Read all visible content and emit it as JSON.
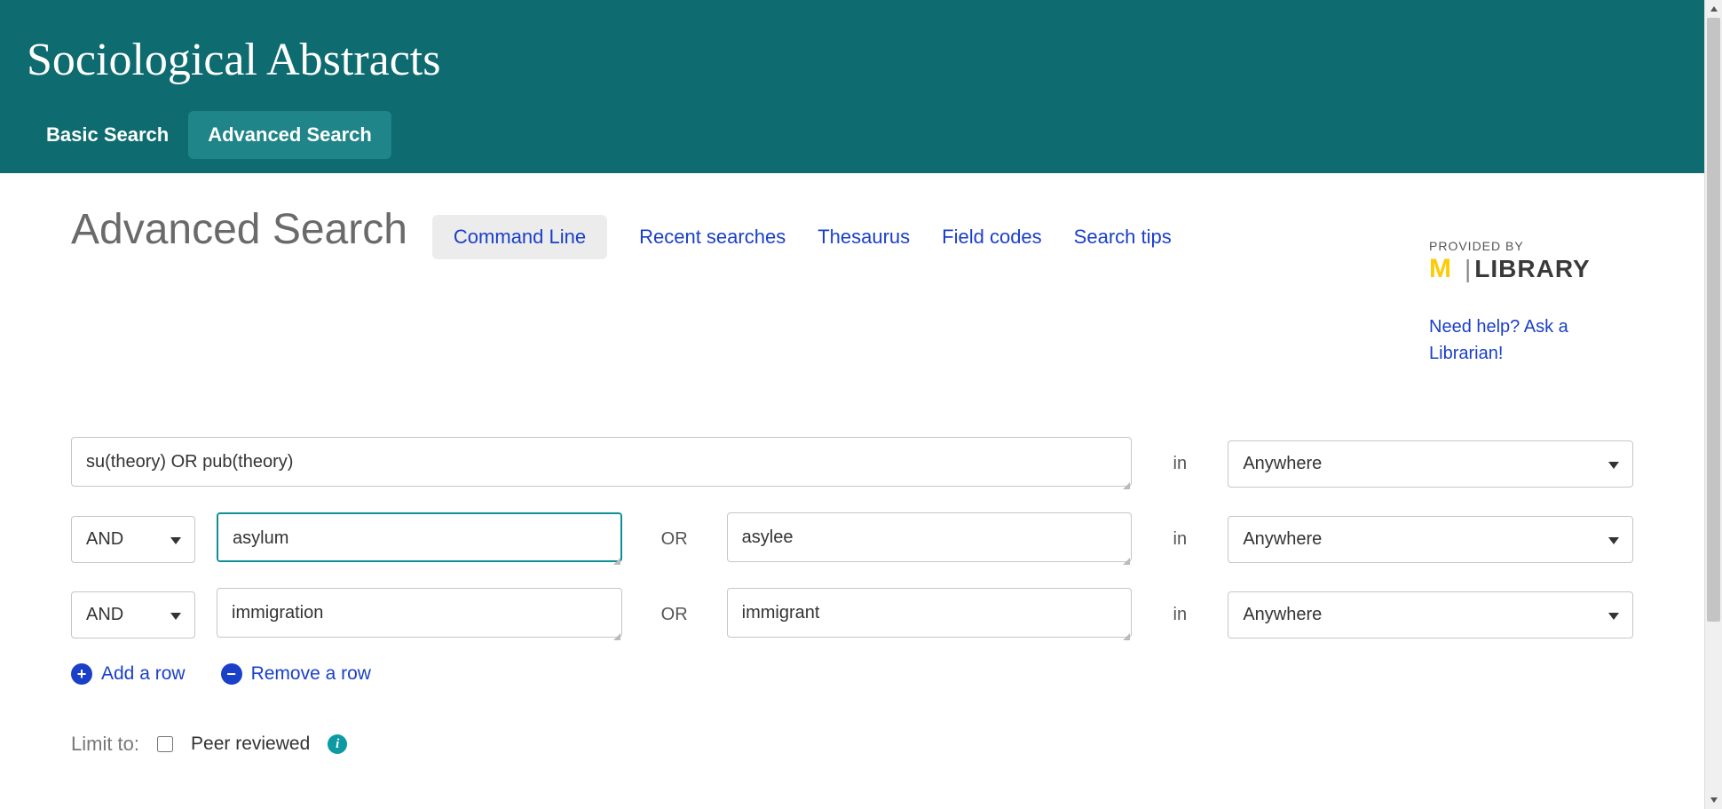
{
  "header": {
    "database_title": "Sociological Abstracts",
    "tabs": [
      {
        "label": "Basic Search",
        "active": false
      },
      {
        "label": "Advanced Search",
        "active": true
      }
    ]
  },
  "page": {
    "title": "Advanced Search",
    "toolbar": {
      "command_line": "Command Line",
      "links": [
        "Recent searches",
        "Thesaurus",
        "Field codes",
        "Search tips"
      ]
    }
  },
  "provider": {
    "provided_by": "PROVIDED BY",
    "logo_m": "M",
    "logo_text": "LIBRARY",
    "help_link": "Need help? Ask a Librarian!"
  },
  "form": {
    "in_label": "in",
    "or_label": "OR",
    "rows": [
      {
        "operator": null,
        "term1": "su(theory) OR pub(theory)",
        "term2": null,
        "field": "Anywhere"
      },
      {
        "operator": "AND",
        "term1": "asylum",
        "term2": "asylee",
        "field": "Anywhere",
        "focused": true
      },
      {
        "operator": "AND",
        "term1": "immigration",
        "term2": "immigrant",
        "field": "Anywhere"
      }
    ],
    "actions": {
      "add_row": "Add a row",
      "remove_row": "Remove a row"
    },
    "limit": {
      "label": "Limit to:",
      "peer_reviewed_label": "Peer reviewed",
      "peer_reviewed_checked": false
    }
  }
}
